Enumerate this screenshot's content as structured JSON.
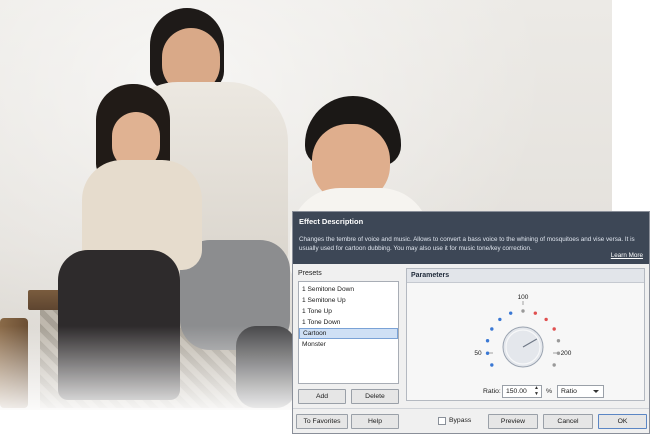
{
  "dialog": {
    "description": {
      "title": "Effect Description",
      "text": "Changes the tembre of voice and music. Allows to convert a bass voice to the whining of mosquitoes and vise versa. It is usually used for cartoon dubbing. You may also use it for music tone/key correction.",
      "learn_more": "Learn More"
    },
    "presets": {
      "label": "Presets",
      "items": [
        "1 Semitone Down",
        "1 Semitone Up",
        "1 Tone Up",
        "1 Tone Down",
        "Cartoon",
        "Monster"
      ],
      "selected": "Cartoon",
      "add_label": "Add",
      "delete_label": "Delete"
    },
    "parameters": {
      "title": "Parameters",
      "dial": {
        "min_label": "50",
        "mid_label": "100",
        "max_label": "200",
        "colors": {
          "low": "#3a78d4",
          "high": "#e05050",
          "neutral": "#9a9a9a"
        }
      },
      "ratio_label": "Ratio:",
      "ratio_value": "150.00",
      "unit": "%",
      "mode_selected": "Ratio"
    },
    "footer": {
      "favorites_label": "To Favorites",
      "help_label": "Help",
      "bypass_label": "Bypass",
      "bypass_checked": false,
      "preview_label": "Preview",
      "cancel_label": "Cancel",
      "ok_label": "OK"
    }
  }
}
